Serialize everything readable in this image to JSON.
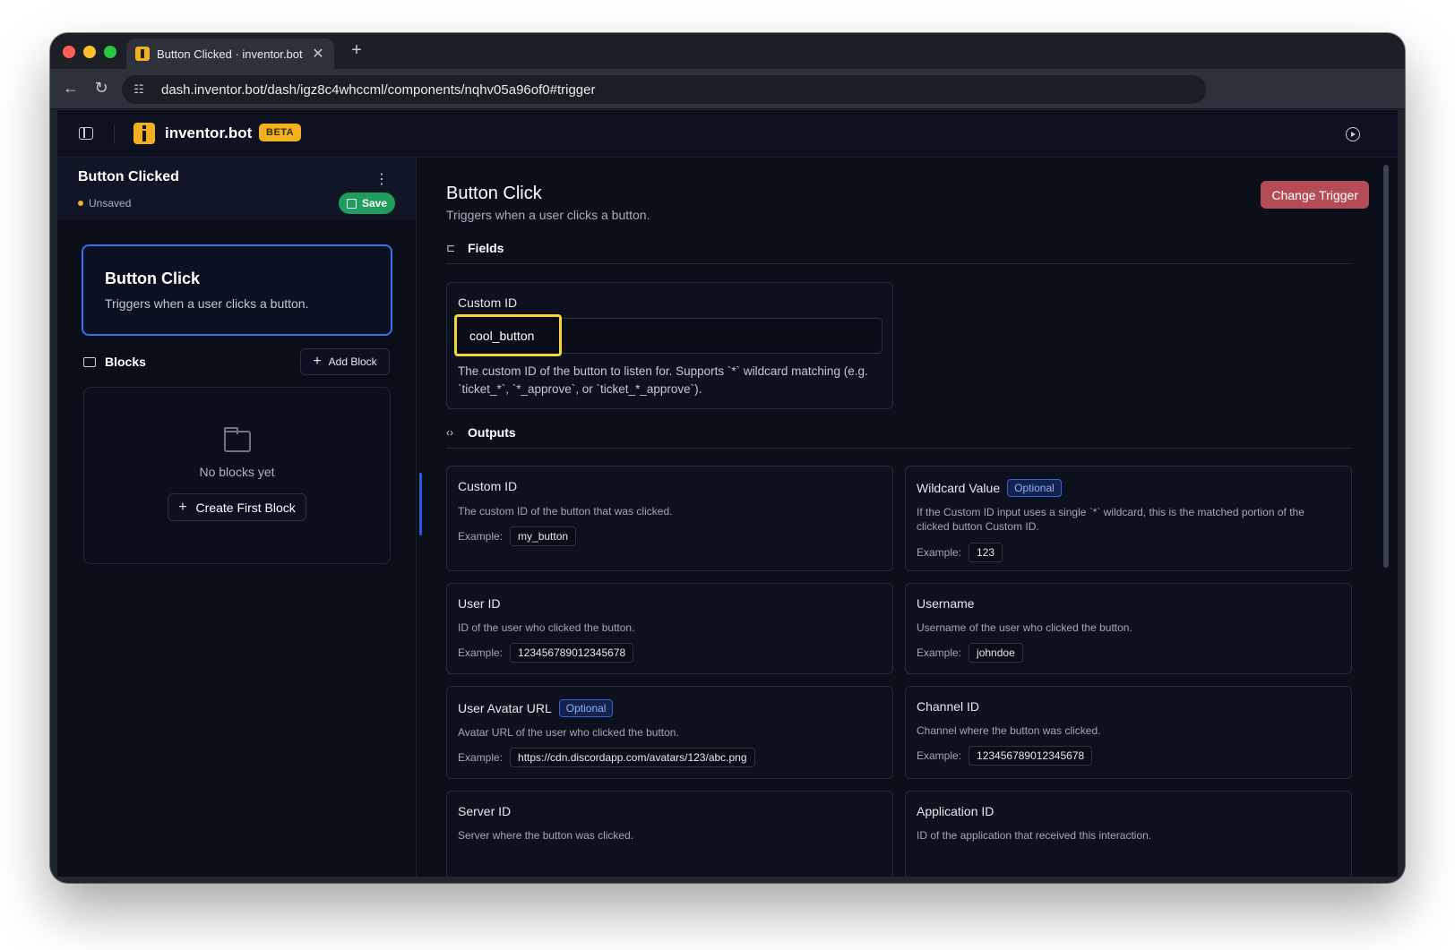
{
  "browser": {
    "tab_title": "Button Clicked · inventor.bot",
    "new_tab": "+",
    "tab_close": "✕",
    "url": "dash.inventor.bot/dash/igz8c4whccml/components/nqhv05a96of0#trigger"
  },
  "appbar": {
    "brand": "inventor.bot",
    "badge": "BETA"
  },
  "workflow": {
    "title": "Button Clicked",
    "status": "Unsaved",
    "save_label": "Save"
  },
  "trigger_card": {
    "title": "Button Click",
    "description": "Triggers when a user clicks a button."
  },
  "blocks": {
    "heading": "Blocks",
    "add_label": "Add Block",
    "empty_text": "No blocks yet",
    "create_label": "Create First Block"
  },
  "main": {
    "title": "Button Click",
    "subtitle": "Triggers when a user clicks a button.",
    "change_trigger_label": "Change Trigger",
    "fields_heading": "Fields",
    "outputs_heading": "Outputs"
  },
  "field": {
    "label": "Custom ID",
    "value": "cool_button",
    "help": "The custom ID of the button to listen for. Supports `*` wildcard matching (e.g. `ticket_*`, `*_approve`, or `ticket_*_approve`)."
  },
  "example_label": "Example:",
  "optional_label": "Optional",
  "outputs": [
    {
      "title": "Custom ID",
      "optional": false,
      "description": "The custom ID of the button that was clicked.",
      "example": "my_button"
    },
    {
      "title": "Wildcard Value",
      "optional": true,
      "description": "If the Custom ID input uses a single `*` wildcard, this is the matched portion of the clicked button Custom ID.",
      "example": "123"
    },
    {
      "title": "User ID",
      "optional": false,
      "description": "ID of the user who clicked the button.",
      "example": "123456789012345678"
    },
    {
      "title": "Username",
      "optional": false,
      "description": "Username of the user who clicked the button.",
      "example": "johndoe"
    },
    {
      "title": "User Avatar URL",
      "optional": true,
      "description": "Avatar URL of the user who clicked the button.",
      "example": "https://cdn.discordapp.com/avatars/123/abc.png"
    },
    {
      "title": "Channel ID",
      "optional": false,
      "description": "Channel where the button was clicked.",
      "example": "123456789012345678"
    },
    {
      "title": "Server ID",
      "optional": false,
      "description": "Server where the button was clicked.",
      "example": ""
    },
    {
      "title": "Application ID",
      "optional": false,
      "description": "ID of the application that received this interaction.",
      "example": ""
    }
  ],
  "colors": {
    "accent_blue": "#3b6ff5",
    "brand_yellow": "#f2b01e",
    "save_green": "#1f9d5c",
    "danger_red": "#b44c57",
    "focus_yellow": "#f5d53a"
  }
}
